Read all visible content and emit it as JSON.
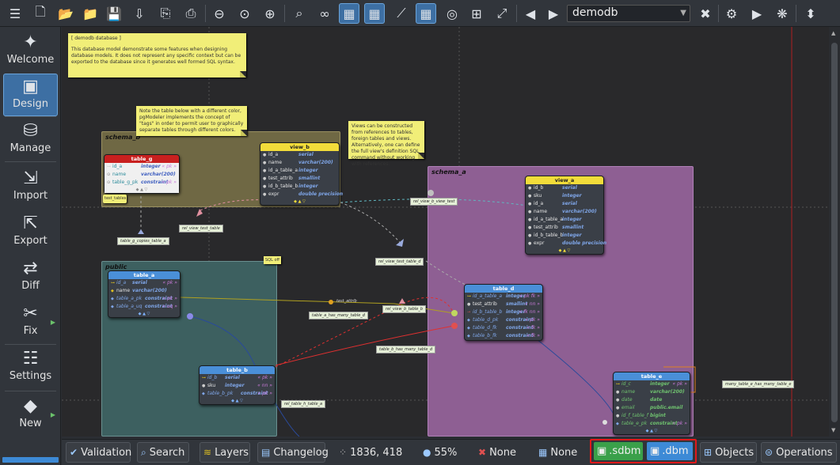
{
  "toolbar": {
    "icons": [
      "menu-icon",
      "new-model-icon",
      "open-icon",
      "open-folder-icon",
      "save-icon",
      "save-as-icon",
      "save-all-icon",
      "print-icon",
      "zoom-out-icon",
      "zoom-reset-icon",
      "zoom-in-icon",
      "find-icon",
      "binoculars-icon",
      "grid-icon",
      "align-grid-icon",
      "magnet-icon",
      "page-delimiter-icon",
      "snapshot-icon",
      "expand-icon",
      "collapse-icon",
      "back-icon",
      "forward-icon"
    ],
    "model_name": "demodb",
    "right_icons": [
      "close-model-icon",
      "plugin-icon",
      "run-icon",
      "swatch-icon",
      "pin-icon"
    ]
  },
  "sidebar": {
    "items": [
      {
        "label": "Welcome",
        "icon": "welcome-icon"
      },
      {
        "label": "Design",
        "icon": "design-icon"
      },
      {
        "label": "Manage",
        "icon": "manage-icon"
      },
      {
        "label": "Import",
        "icon": "import-icon"
      },
      {
        "label": "Export",
        "icon": "export-icon"
      },
      {
        "label": "Diff",
        "icon": "diff-icon"
      },
      {
        "label": "Fix",
        "icon": "fix-icon"
      },
      {
        "label": "Settings",
        "icon": "settings-icon"
      },
      {
        "label": "New",
        "icon": "new-icon"
      }
    ]
  },
  "canvas": {
    "notes": {
      "database": {
        "title": "[ demodb database ]",
        "body": "This database model demonstrate some features when designing database models. It does not represent any specific context but can be exported to the database since it generates well formed SQL syntax."
      },
      "tags": {
        "body": "Note the table below with a different color, pgModeler implements the concept of \"tags\" in order to permit user to graphically separate tables through different colors."
      },
      "views": {
        "body": "Views can be constructed from references to tables, foreign tables and views. Alternatively, one can define the full view's definition SQL command without working with references."
      },
      "sql_off": {
        "body": "SQL off"
      }
    },
    "schemas": {
      "schema_b": "schema_b",
      "schema_a": "schema_a",
      "public": "public"
    },
    "tables": {
      "table_g": {
        "name": "table_g",
        "rows": [
          {
            "c": "id_a",
            "t": "integer",
            "k": "« pk »"
          },
          {
            "c": "name",
            "t": "varchar(200)",
            "k": ""
          },
          {
            "c": "table_g_pk",
            "t": "constraint",
            "k": "« pk »"
          }
        ],
        "tag": "test_tables"
      },
      "view_b": {
        "name": "view_b",
        "rows": [
          {
            "c": "id_a",
            "t": "serial",
            "k": ""
          },
          {
            "c": "name",
            "t": "varchar(200)",
            "k": ""
          },
          {
            "c": "id_a_table_a",
            "t": "integer",
            "k": ""
          },
          {
            "c": "test_attrib",
            "t": "smallint",
            "k": ""
          },
          {
            "c": "id_b_table_b",
            "t": "integer",
            "k": ""
          },
          {
            "c": "expr",
            "t": "double precision",
            "k": ""
          }
        ]
      },
      "view_a": {
        "name": "view_a",
        "rows": [
          {
            "c": "id_b",
            "t": "serial",
            "k": ""
          },
          {
            "c": "sku",
            "t": "integer",
            "k": ""
          },
          {
            "c": "id_a",
            "t": "serial",
            "k": ""
          },
          {
            "c": "name",
            "t": "varchar(200)",
            "k": ""
          },
          {
            "c": "id_a_table_a",
            "t": "integer",
            "k": ""
          },
          {
            "c": "test_attrib",
            "t": "smallint",
            "k": ""
          },
          {
            "c": "id_b_table_b",
            "t": "integer",
            "k": ""
          },
          {
            "c": "expr",
            "t": "double precision",
            "k": ""
          }
        ]
      },
      "table_a": {
        "name": "table_a",
        "rows": [
          {
            "c": "id_a",
            "t": "serial",
            "k": "« pk »"
          },
          {
            "c": "name",
            "t": "varchar(200)",
            "k": ""
          },
          {
            "c": "table_a_pk",
            "t": "constraint",
            "k": "« pk »"
          },
          {
            "c": "table_a_uq",
            "t": "constraint",
            "k": "« uq »"
          }
        ]
      },
      "table_d": {
        "name": "table_d",
        "rows": [
          {
            "c": "id_a_table_a",
            "t": "integer",
            "k": "« pk fk »"
          },
          {
            "c": "test_attrib",
            "t": "smallint",
            "k": "« nn »"
          },
          {
            "c": "id_b_table_b",
            "t": "integer",
            "k": "« fk nn »"
          },
          {
            "c": "table_d_pk",
            "t": "constraint",
            "k": "« pk »"
          },
          {
            "c": "table_d_fk",
            "t": "constraint",
            "k": "« fk »"
          },
          {
            "c": "table_b_fk",
            "t": "constraint",
            "k": "« fk »"
          }
        ]
      },
      "table_b": {
        "name": "table_b",
        "rows": [
          {
            "c": "id_b",
            "t": "serial",
            "k": "« pk »"
          },
          {
            "c": "sku",
            "t": "integer",
            "k": "« nn »"
          },
          {
            "c": "table_b_pk",
            "t": "constraint",
            "k": "« pk »"
          }
        ]
      },
      "table_e": {
        "name": "table_e",
        "rows": [
          {
            "c": "id_c",
            "t": "integer",
            "k": "« pk »"
          },
          {
            "c": "name",
            "t": "varchar(200)",
            "k": ""
          },
          {
            "c": "date",
            "t": "date",
            "k": ""
          },
          {
            "c": "email",
            "t": "public.email",
            "k": ""
          },
          {
            "c": "id_f_table_f",
            "t": "bigint",
            "k": ""
          },
          {
            "c": "table_e_pk",
            "t": "constraint",
            "k": "« pk »"
          }
        ]
      }
    },
    "relations": {
      "rel_view_test_table": "rel_view_test_table",
      "table_g_copies_table_a": "table_g_copies_table_a",
      "rel_view_b_view_test": "rel_view_b_view_test",
      "rel_view_test_table_d": "rel_view_test_table_d",
      "test_attrib": "test_attrib",
      "rel_view_b_table_b": "rel_view_b_table_b",
      "table_a_has_many_table_d": "table_a_has_many_table_d",
      "table_b_has_many_table_d": "table_b_has_many_table_d",
      "rel_table_h_table_a": "rel_table_h_table_a",
      "many_table_e_has_many_table_e": "many_table_e_has_many_table_e"
    }
  },
  "status": {
    "validation": "Validation",
    "search": "Search",
    "layers": "Layers",
    "changelog": "Changelog",
    "coords": "1836, 418",
    "zoom": "55%",
    "none1": "None",
    "none2": "None",
    "sdbm": ".sdbm",
    "dbm": ".dbm",
    "objects": "Objects",
    "operations": "Operations"
  }
}
